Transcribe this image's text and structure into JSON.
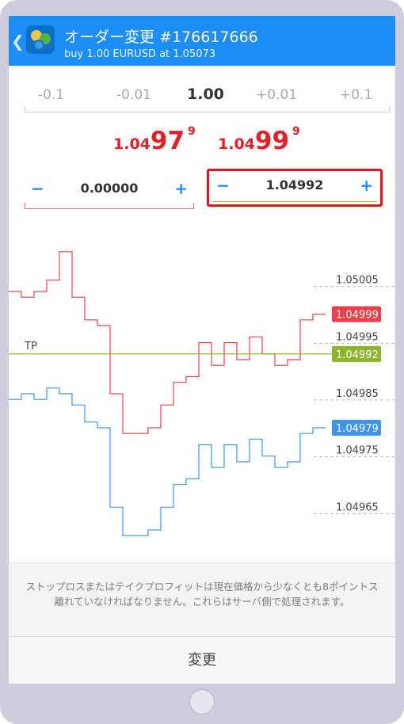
{
  "header": {
    "back_symbol": "❮",
    "title": "オーダー変更 #176617666",
    "subtitle": "buy 1.00 EURUSD at 1.05073"
  },
  "volume": {
    "steps": [
      "-0.1",
      "-0.01",
      "1.00",
      "+0.01",
      "+0.1"
    ],
    "selected": "1.00"
  },
  "prices": {
    "bid": {
      "prefix": "1.04",
      "big": "97",
      "sup": "9"
    },
    "ask": {
      "prefix": "1.04",
      "big": "99",
      "sup": "9"
    }
  },
  "stop_loss": {
    "minus": "−",
    "plus": "+",
    "value": "0.00000"
  },
  "take_profit": {
    "minus": "−",
    "plus": "+",
    "value": "1.04992"
  },
  "chart": {
    "tp_label": "TP",
    "ask_tag": "1.04999",
    "tp_tag": "1.04992",
    "bid_tag": "1.04979",
    "ask_color": "#e8404a",
    "bid_color": "#3f95e6",
    "tp_color": "#8ab52c"
  },
  "chart_data": {
    "type": "line",
    "y_ticks": [
      "1.05005",
      "1.04995",
      "1.04985",
      "1.04975",
      "1.04965"
    ],
    "series": [
      {
        "values": [
          1.05003,
          1.05002,
          1.05003,
          1.05005,
          1.0501,
          1.05002,
          1.04998,
          1.04997,
          1.04985,
          1.04978,
          1.04978,
          1.04979,
          1.04983,
          1.04987,
          1.04988,
          1.04994,
          1.0499,
          1.04994,
          1.04991,
          1.04995,
          1.04992,
          1.0499,
          1.04991,
          1.04998,
          1.04999,
          1.04999
        ]
      },
      {
        "values": [
          1.04984,
          1.04985,
          1.04984,
          1.04986,
          1.04985,
          1.04983,
          1.0498,
          1.04979,
          1.04965,
          1.0496,
          1.0496,
          1.04961,
          1.04965,
          1.04969,
          1.0497,
          1.04976,
          1.04972,
          1.04976,
          1.04973,
          1.04977,
          1.04974,
          1.04972,
          1.04973,
          1.04978,
          1.04979,
          1.04979
        ]
      }
    ],
    "horizontal_line": {
      "label": "TP",
      "value": 1.04992
    }
  },
  "notice": {
    "text": "ストップロスまたはテイクプロフィットは現在価格から少なくとも8ポイントス離れていなければなりません。これらはサーバ側で処理されます。"
  },
  "action": {
    "label": "変更"
  }
}
